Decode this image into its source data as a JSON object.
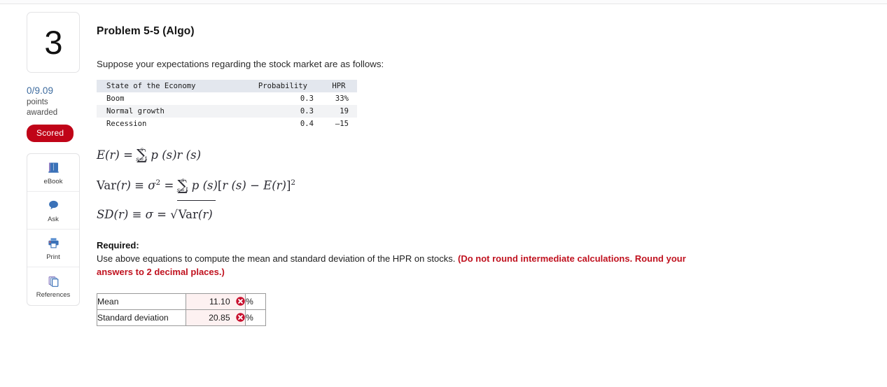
{
  "question": {
    "number": "3",
    "points_awarded": "0/9.09",
    "points_label": "points awarded",
    "status_badge": "Scored",
    "badge_color": "#c00418"
  },
  "tools": [
    {
      "label": "eBook",
      "icon": "ebook-icon"
    },
    {
      "label": "Ask",
      "icon": "chat-bubble-icon"
    },
    {
      "label": "Print",
      "icon": "printer-icon"
    },
    {
      "label": "References",
      "icon": "copy-pages-icon"
    }
  ],
  "problem": {
    "title": "Problem 5-5 (Algo)",
    "intro": "Suppose your expectations regarding the stock market are as follows:"
  },
  "econ_table": {
    "headers": [
      "State of the Economy",
      "Probability",
      "HPR"
    ],
    "rows": [
      {
        "state": "Boom",
        "probability": "0.3",
        "hpr": "33%"
      },
      {
        "state": "Normal growth",
        "probability": "0.3",
        "hpr": "19"
      },
      {
        "state": "Recession",
        "probability": "0.4",
        "hpr": "–15"
      }
    ]
  },
  "formulas": {
    "expected_return": "E (r) = ∑_{s=1}^{s} p (s) r (s)",
    "variance": "Var (r) ≡ σ² = ∑_{s=1}^{s} p (s)[r (s) − E (r)]²",
    "std_dev": "SD (r) ≡ σ = √Var (r)",
    "parts": {
      "E": "E",
      "r_paren": "(r)",
      "eq": "=",
      "sigma_glyph": "∑",
      "limit_top": "s",
      "limit_bottom": "s=1",
      "p_s": "p (s)",
      "r_s": "r (s)",
      "Var": "Var",
      "equiv": "≡",
      "sigma": "σ",
      "sq": "2",
      "bracket_open": "[",
      "bracket_close": "]",
      "minus": "−",
      "SD": "SD",
      "radical": "√"
    }
  },
  "required": {
    "heading": "Required:",
    "text": "Use above equations to compute the mean and standard deviation of the HPR on stocks.",
    "note_line1": "(Do not round intermediate calculations.",
    "note_line2": "Round your answers to 2 decimal places.)",
    "note_color": "#c0121f"
  },
  "answer_table": {
    "rows": [
      {
        "label": "Mean",
        "value": "11.10",
        "unit": "%",
        "mark": "incorrect"
      },
      {
        "label": "Standard deviation",
        "value": "20.85",
        "unit": "%",
        "mark": "incorrect"
      }
    ],
    "mark_color": "#c8102e",
    "value_bg": "#fdf1f1"
  }
}
